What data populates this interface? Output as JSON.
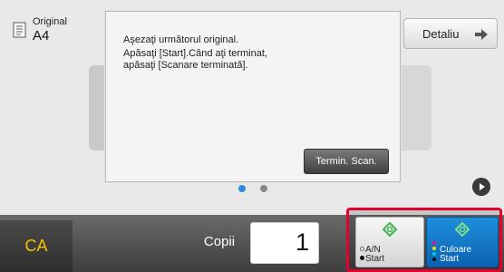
{
  "original": {
    "label": "Original",
    "size": "A4"
  },
  "detail_button": {
    "label": "Detaliu"
  },
  "dialog": {
    "lines": [
      "Aşezaţi următorul original.",
      "Apăsaţi [Start].Când aţi terminat,",
      "apăsaţi [Scanare terminată]."
    ],
    "finish_button": "Termin. Scan."
  },
  "pagination": {
    "current_page": 1,
    "total_pages": 2
  },
  "bottom_bar": {
    "ca_label": "CA",
    "copies_label": "Copii",
    "copies_value": "1",
    "bw_start": {
      "line1": "A/N",
      "line2": "Start"
    },
    "color_start": {
      "line1": "Culoare",
      "line2": "Start"
    }
  },
  "colors": {
    "accent_blue": "#1e8fdc",
    "highlight_red": "#e6002e",
    "ca_yellow": "#f2c400",
    "start_green": "#3cb44b"
  }
}
